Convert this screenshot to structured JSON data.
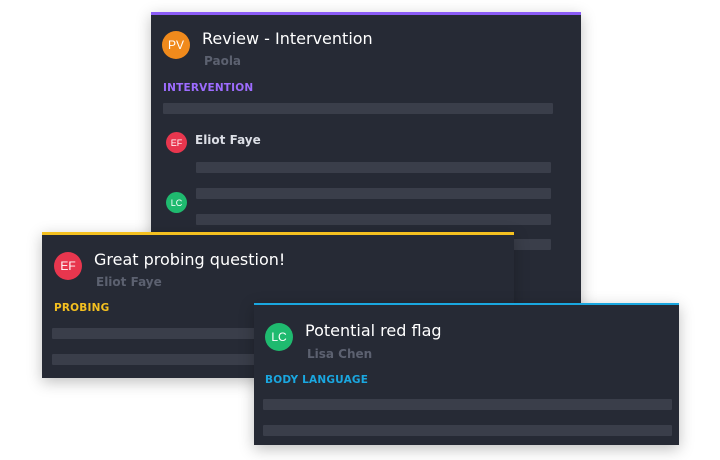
{
  "cards": {
    "review": {
      "avatar": "PV",
      "title": "Review - Intervention",
      "author": "Paola",
      "tag": "INTERVENTION",
      "accent": "#8b5cf6",
      "avatar_color": "#f08a1c",
      "replies": [
        {
          "avatar": "EF",
          "name": "Eliot Faye",
          "avatar_color": "#e8364e"
        },
        {
          "avatar": "LC",
          "name": "",
          "avatar_color": "#1fba6f"
        }
      ]
    },
    "probing": {
      "avatar": "EF",
      "title": "Great probing question!",
      "author": "Eliot Faye",
      "tag": "PROBING",
      "accent": "#f4c020",
      "avatar_color": "#e8364e"
    },
    "red_flag": {
      "avatar": "LC",
      "title": "Potential red flag",
      "author": "Lisa Chen",
      "tag": "BODY LANGUAGE",
      "accent": "#1aa7e0",
      "avatar_color": "#1fba6f"
    }
  }
}
